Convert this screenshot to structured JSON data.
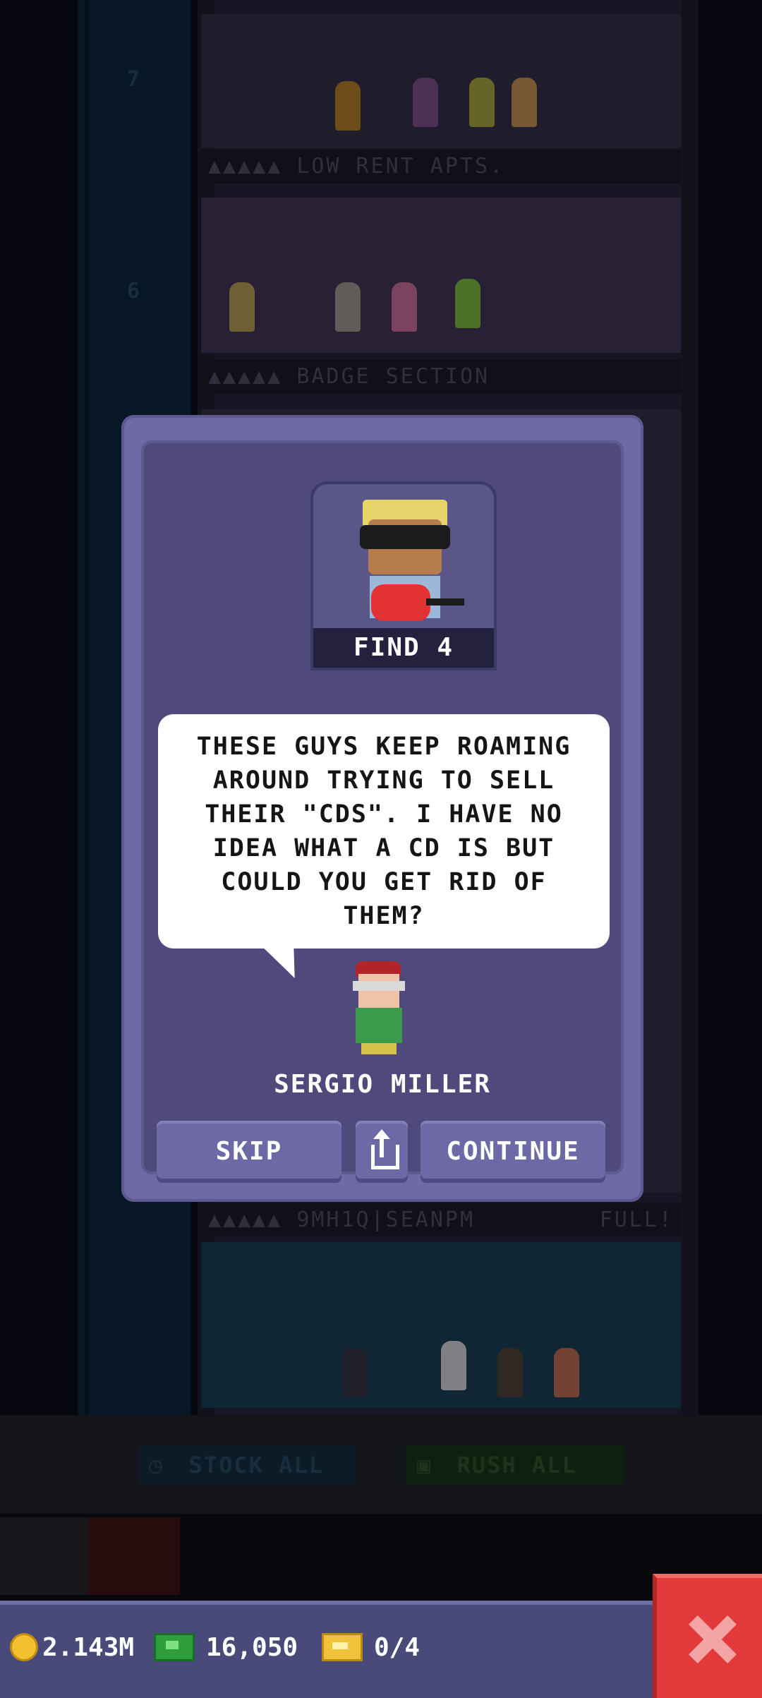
{
  "tower": {
    "floor_numbers": [
      "7",
      "6"
    ],
    "floor_labels": [
      "LOW RENT APTS.",
      "BADGE SECTION",
      "9MH1Q|SEANPM"
    ],
    "floor_status": "FULL!",
    "actions": {
      "stock_label": "STOCK ALL",
      "rush_label": "RUSH ALL"
    }
  },
  "dialog": {
    "badge_label": "FIND 4",
    "message": "THESE GUYS KEEP ROAMING AROUND TRYING TO SELL THEIR \"CDS\". I HAVE NO IDEA WHAT A CD IS BUT COULD YOU GET RID OF THEM?",
    "speaker": "SERGIO MILLER",
    "skip_label": "SKIP",
    "continue_label": "CONTINUE"
  },
  "status": {
    "coins": "2.143M",
    "bux": "16,050",
    "tickets": "0/4"
  },
  "colors": {
    "dialog_bg": "#6f6aa6",
    "dialog_inner": "#4f4a7b",
    "close_red": "#e23a3a",
    "statusbar": "#4a4a7a"
  },
  "icons": [
    "coin-icon",
    "bux-icon",
    "ticket-icon",
    "share-icon",
    "close-icon"
  ]
}
